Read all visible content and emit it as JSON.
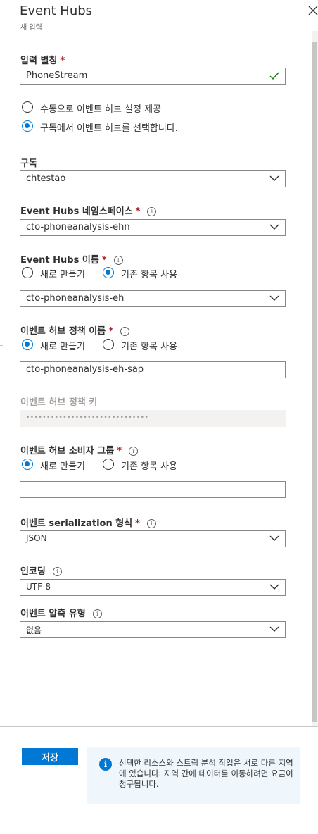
{
  "panel": {
    "title": "Event Hubs",
    "subtitle": "새 입력"
  },
  "form": {
    "alias": {
      "label": "입력 별칭",
      "required": "*",
      "value": "PhoneStream"
    },
    "source_mode": {
      "options": [
        "수동으로 이벤트 허브 설정 제공",
        "구독에서 이벤트 허브를 선택합니다."
      ],
      "selected": 1
    },
    "subscription": {
      "label": "구독",
      "value": "chtestao"
    },
    "namespace": {
      "label": "Event Hubs 네임스페이스",
      "required": "*",
      "value": "cto-phoneanalysis-ehn"
    },
    "hub_name": {
      "label": "Event Hubs 이름",
      "required": "*",
      "options": [
        "새로 만들기",
        "기존 항목 사용"
      ],
      "selected": 1,
      "value": "cto-phoneanalysis-eh"
    },
    "policy_name": {
      "label": "이벤트 허브 정책 이름",
      "required": "*",
      "options": [
        "새로 만들기",
        "기존 항목 사용"
      ],
      "selected": 0,
      "value": "cto-phoneanalysis-eh-sap"
    },
    "policy_key": {
      "label": "이벤트 허브 정책 키",
      "value": "••••••••••••••••••••••••••••••"
    },
    "consumer_group": {
      "label": "이벤트 허브 소비자 그룹",
      "required": "*",
      "options": [
        "새로 만들기",
        "기존 항목 사용"
      ],
      "selected": 0,
      "value": ""
    },
    "serialization": {
      "label": "이벤트 serialization 형식",
      "required": "*",
      "value": "JSON"
    },
    "encoding": {
      "label": "인코딩",
      "value": "UTF-8"
    },
    "compression": {
      "label": "이벤트 압축 유형",
      "value": "없음"
    }
  },
  "footer": {
    "save_label": "저장",
    "info_icon": "i",
    "info_text": "선택한 리소스와 스트림 분석 작업은 서로 다른 지역에 있습니다. 지역 간에 데이터를 이동하려면 요금이 청구됩니다."
  },
  "icons": {
    "close": "close-icon",
    "chevron": "chevron-down-icon",
    "check": "checkmark-icon",
    "info": "info-icon"
  },
  "colors": {
    "accent": "#0078d4",
    "required": "#a4262c",
    "valid_check": "#107c10"
  }
}
